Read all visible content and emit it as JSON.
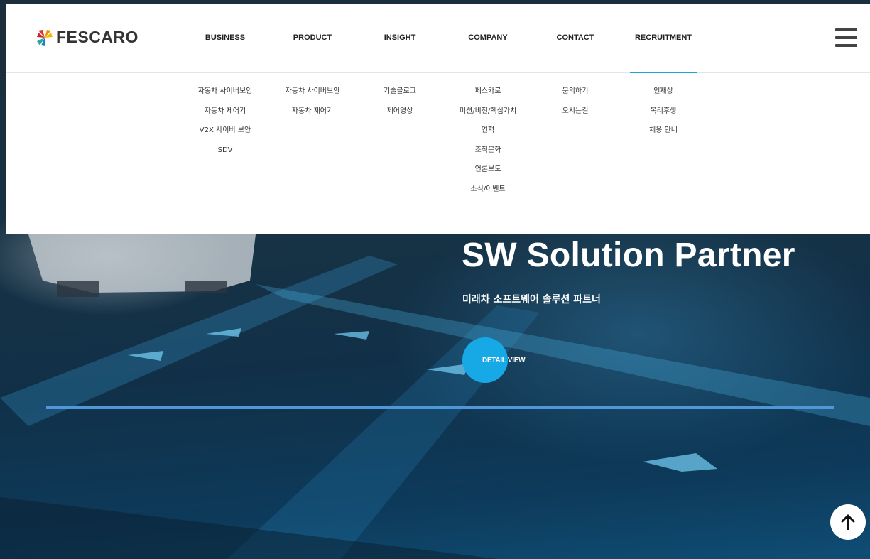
{
  "brand": {
    "name": "FESCARO"
  },
  "nav": {
    "items": [
      {
        "label": "BUSINESS"
      },
      {
        "label": "PRODUCT"
      },
      {
        "label": "INSIGHT"
      },
      {
        "label": "COMPANY"
      },
      {
        "label": "CONTACT"
      },
      {
        "label": "RECRUITMENT"
      }
    ],
    "active": "RECRUITMENT",
    "accent_color": "#1ca3d8"
  },
  "mega_menu": {
    "business": [
      "자동차 사이버보안",
      "자동차 제어기",
      "V2X 사이버 보안",
      "SDV"
    ],
    "product": [
      "자동차 사이버보안",
      "자동차 제어기"
    ],
    "insight": [
      "기술블로그",
      "제어영상"
    ],
    "company": [
      "페스카로",
      "미션/비전/핵심가치",
      "연혁",
      "조직문화",
      "언론보도",
      "소식/이벤트"
    ],
    "contact": [
      "문의하기",
      "오시는길"
    ],
    "recruitment": [
      "인재상",
      "복리후생",
      "채용 안내"
    ]
  },
  "hero": {
    "title": "SW Solution Partner",
    "subtitle": "미래차 소프트웨어 솔루션 파트너",
    "button_label": "DETAIL VIEW",
    "button_color": "#16a9e6",
    "progress_color": "#4f97d8",
    "progress": 1.0
  },
  "icons": {
    "menu": "hamburger-menu-icon",
    "scroll_top": "arrow-up-icon",
    "logo": "fescaro-logo-icon"
  }
}
